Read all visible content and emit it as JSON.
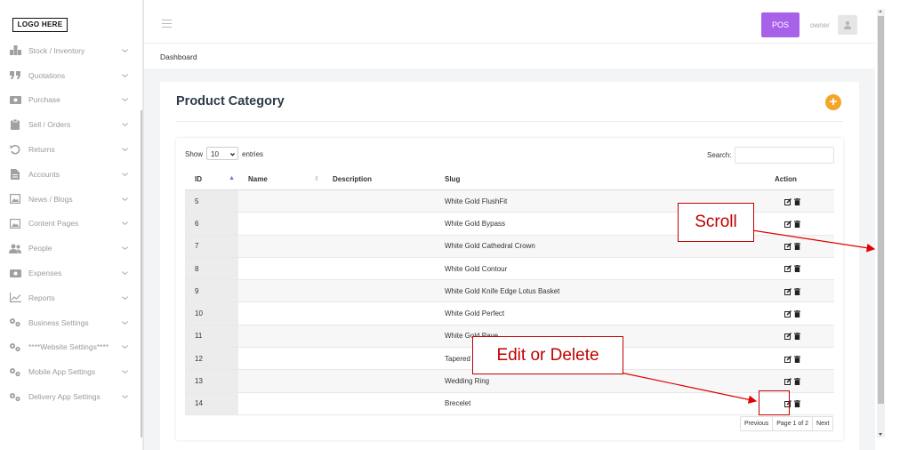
{
  "brand": {
    "logo": "LOGO HERE"
  },
  "sidebar": {
    "items": [
      {
        "label": "Stock / Inventory",
        "icon": "warehouse-icon"
      },
      {
        "label": "Quotations",
        "icon": "quote-icon"
      },
      {
        "label": "Purchase",
        "icon": "money-icon"
      },
      {
        "label": "Sell / Orders",
        "icon": "clipboard-icon"
      },
      {
        "label": "Returns",
        "icon": "undo-icon"
      },
      {
        "label": "Accounts",
        "icon": "file-icon"
      },
      {
        "label": "News / Blogs",
        "icon": "image-icon"
      },
      {
        "label": "Content Pages",
        "icon": "image-icon"
      },
      {
        "label": "People",
        "icon": "users-icon"
      },
      {
        "label": "Expenses",
        "icon": "money-icon"
      },
      {
        "label": "Reports",
        "icon": "line-chart-icon"
      },
      {
        "label": "Business Settings",
        "icon": "cogs-icon"
      },
      {
        "label": "****Website Settings****",
        "icon": "cogs-icon"
      },
      {
        "label": "Mobile App Settings",
        "icon": "cogs-icon"
      },
      {
        "label": "Delivery App Settings",
        "icon": "cogs-icon"
      }
    ]
  },
  "header": {
    "pos_label": "POS",
    "user_name": "owner"
  },
  "breadcrumb": {
    "current": "Dashboard"
  },
  "page": {
    "title": "Product Category"
  },
  "table": {
    "show_label": "Show",
    "entries_value": "10",
    "entries_label": "entries",
    "search_label": "Search:",
    "columns": {
      "id": "ID",
      "name": "Name",
      "description": "Description",
      "slug": "Slug",
      "action": "Action"
    },
    "rows": [
      {
        "id": "5",
        "name": "",
        "description": "",
        "slug": "White Gold FlushFit"
      },
      {
        "id": "6",
        "name": "",
        "description": "",
        "slug": "White Gold Bypass"
      },
      {
        "id": "7",
        "name": "",
        "description": "",
        "slug": "White Gold Cathedral Crown"
      },
      {
        "id": "8",
        "name": "",
        "description": "",
        "slug": "White Gold Contour"
      },
      {
        "id": "9",
        "name": "",
        "description": "",
        "slug": "White Gold Knife Edge Lotus Basket"
      },
      {
        "id": "10",
        "name": "",
        "description": "",
        "slug": "White Gold Perfect"
      },
      {
        "id": "11",
        "name": "",
        "description": "",
        "slug": "White Gold Pave"
      },
      {
        "id": "12",
        "name": "",
        "description": "",
        "slug": "Tapered Pave"
      },
      {
        "id": "13",
        "name": "",
        "description": "",
        "slug": "Wedding Ring"
      },
      {
        "id": "14",
        "name": "",
        "description": "",
        "slug": "Brecelet"
      }
    ]
  },
  "pagination": {
    "previous": "Previous",
    "page_info": "Page 1 of 2",
    "next": "Next"
  },
  "annotations": {
    "scroll": "Scroll",
    "edit_delete": "Edit or Delete"
  },
  "colors": {
    "pos": "#a862ea",
    "add": "#f4a62a",
    "annotation": "#c00000"
  }
}
